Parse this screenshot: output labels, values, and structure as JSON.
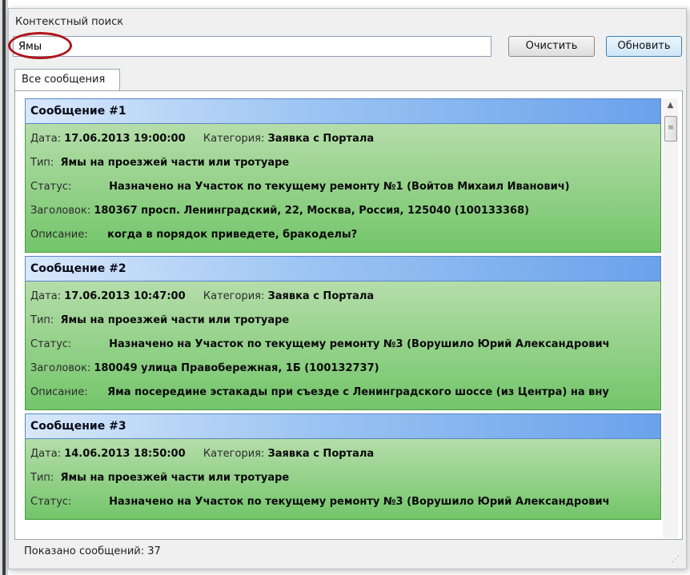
{
  "search": {
    "label": "Контекстный поиск",
    "value": "Ямы",
    "clear_label": "Очистить",
    "refresh_label": "Обновить"
  },
  "tabs": [
    {
      "label": "Все сообщения",
      "active": true
    }
  ],
  "field_labels": {
    "date": "Дата:",
    "category": "Категория:",
    "type": "Тип:",
    "status": "Статус:",
    "title": "Заголовок:",
    "description": "Описание:"
  },
  "messages": [
    {
      "header": "Сообщение #1",
      "date": "17.06.2013 19:00:00",
      "category": "Заявка с Портала",
      "type": "Ямы на проезжей части или тротуаре",
      "status": "Назначено на Участок по текущему ремонту №1 (Войтов Михаил Иванович)",
      "title": "180367  просп. Ленинградский, 22, Москва, Россия, 125040 (100133368)",
      "description": "когда в порядок приведете, бракоделы?"
    },
    {
      "header": "Сообщение #2",
      "date": "17.06.2013 10:47:00",
      "category": "Заявка с Портала",
      "type": "Ямы на проезжей части или тротуаре",
      "status": "Назначено на Участок по текущему ремонту №3 (Ворушило Юрий Александрович",
      "title": "180049  улица Правобережная, 1Б (100132737)",
      "description": "Яма посередине эстакады при съезде с Ленинградского шоссе (из Центра) на вну"
    },
    {
      "header": "Сообщение #3",
      "date": "14.06.2013 18:50:00",
      "category": "Заявка с Портала",
      "type": "Ямы на проезжей части или тротуаре",
      "status": "Назначено на Участок по текущему ремонту №3 (Ворушило Юрий Александрович"
    }
  ],
  "status_bar": {
    "text": "Показано сообщений: 37"
  },
  "colors": {
    "header_blue": "#6aa2eb",
    "body_green": "#73c56a",
    "highlight_red": "#b0141a"
  }
}
